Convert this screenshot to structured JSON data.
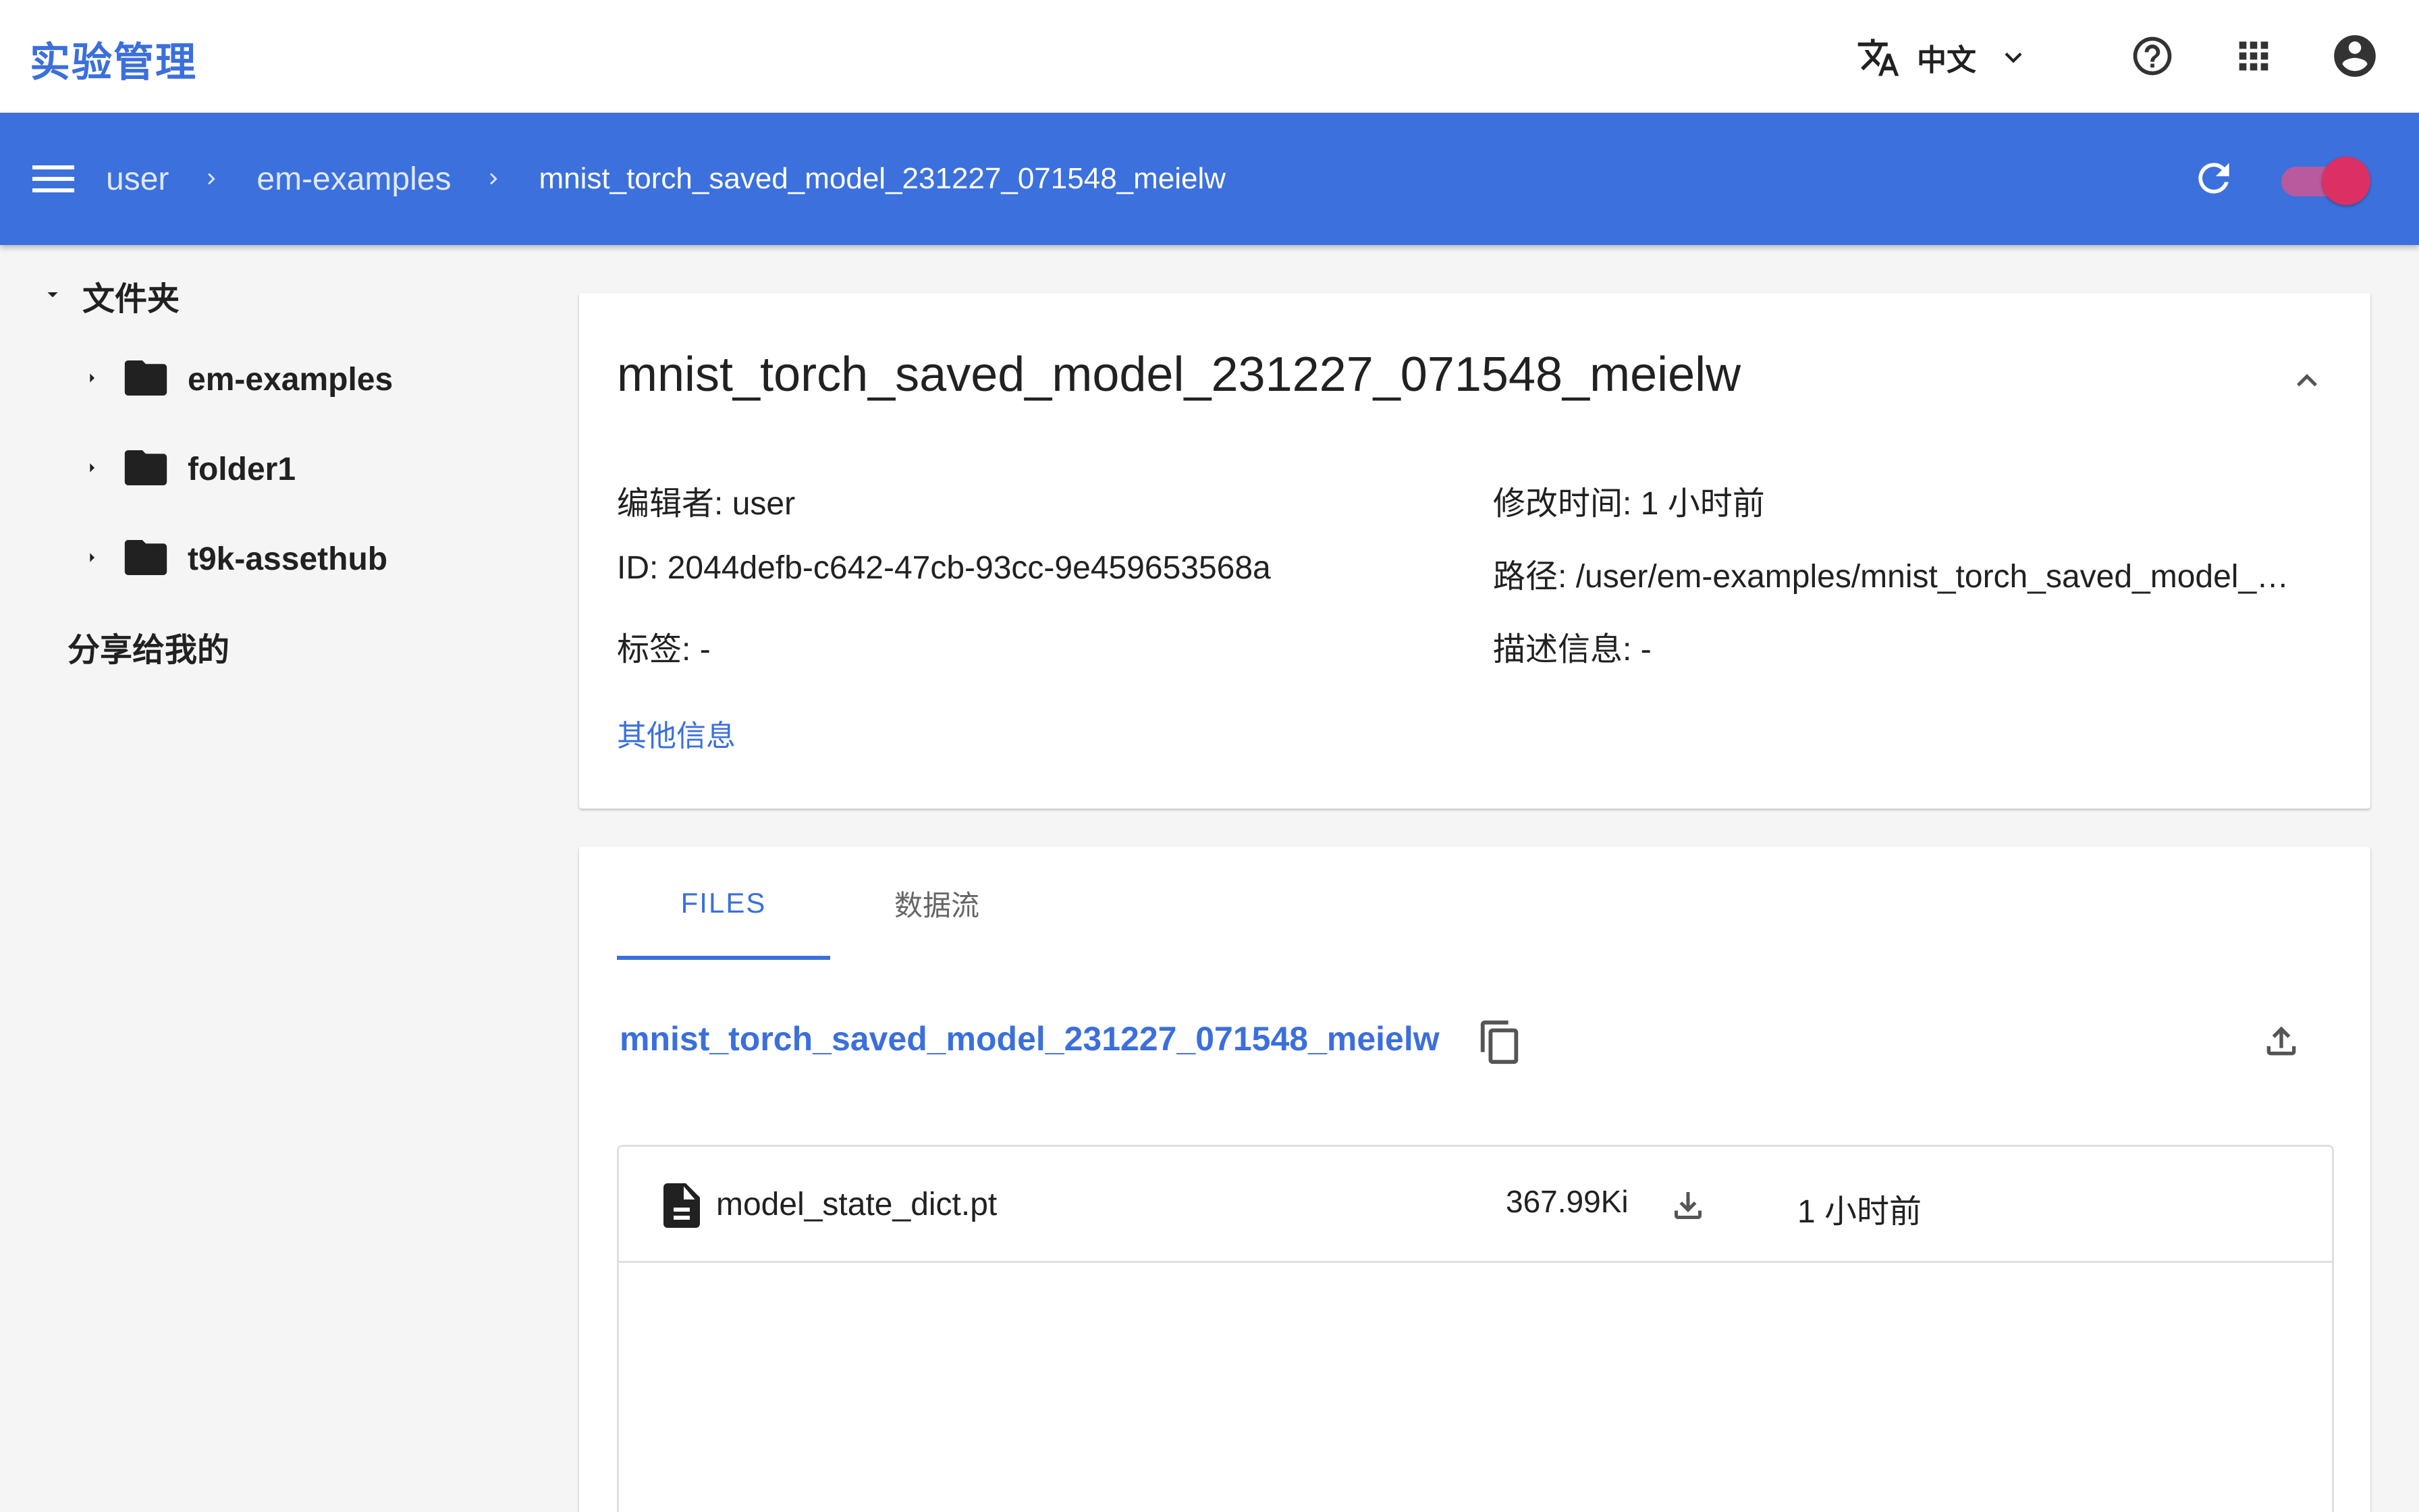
{
  "app": {
    "title": "实验管理"
  },
  "topbar": {
    "language_label": "中文"
  },
  "breadcrumb": {
    "items": [
      "user",
      "em-examples",
      "mnist_torch_saved_model_231227_071548_meielw"
    ]
  },
  "sidebar": {
    "root_label": "文件夹",
    "folders": [
      "em-examples",
      "folder1",
      "t9k-assethub"
    ],
    "shared_label": "分享给我的"
  },
  "info": {
    "title": "mnist_torch_saved_model_231227_071548_meielw",
    "editor_key": "编辑者:",
    "editor_value": "user",
    "modified_key": "修改时间:",
    "modified_value": "1 小时前",
    "id_key": "ID:",
    "id_value": "2044defb-c642-47cb-93cc-9e459653568a",
    "path_key": "路径:",
    "path_value": "/user/em-examples/mnist_torch_saved_model_…",
    "tags_key": "标签:",
    "tags_value": "-",
    "desc_key": "描述信息:",
    "desc_value": "-",
    "more_info_label": "其他信息"
  },
  "files": {
    "tabs": [
      "FILES",
      "数据流"
    ],
    "active_tab": "FILES",
    "current_path": "mnist_torch_saved_model_231227_071548_meielw",
    "rows": [
      {
        "name": "model_state_dict.pt",
        "size": "367.99Ki",
        "modified": "1 小时前"
      }
    ]
  },
  "colors": {
    "accent": "#3b6fdc",
    "bar": "#3c70dd",
    "toggle_knob": "#dc2f63",
    "toggle_track": "#b85a9d"
  },
  "icons": [
    "translate-icon",
    "chevron-down-icon",
    "help-icon",
    "apps-grid-icon",
    "account-circle-icon",
    "menu-icon",
    "chevron-right-icon",
    "refresh-icon",
    "caret-down-icon",
    "caret-right-icon",
    "folder-icon",
    "chevron-up-icon",
    "copy-icon",
    "upload-icon",
    "file-document-icon",
    "download-icon"
  ]
}
